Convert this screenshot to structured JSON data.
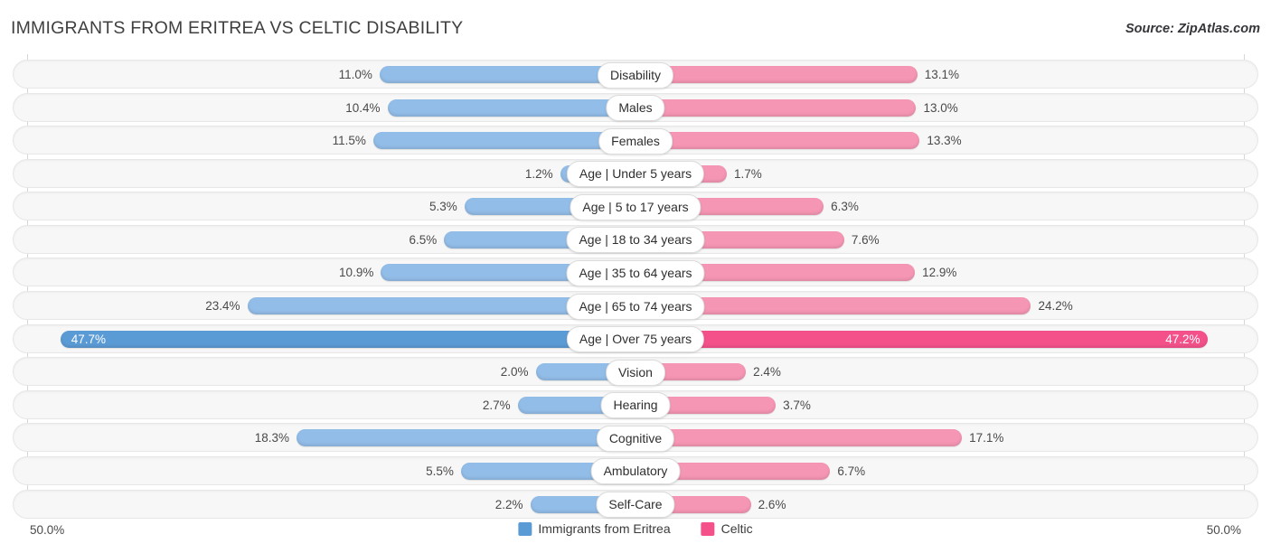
{
  "header": {
    "title": "IMMIGRANTS FROM ERITREA VS CELTIC DISABILITY",
    "source": "Source: ZipAtlas.com"
  },
  "axis": {
    "left_label": "50.0%",
    "right_label": "50.0%",
    "max": 50.0
  },
  "legend": {
    "items": [
      {
        "label": "Immigrants from Eritrea",
        "color": "#5b9bd5"
      },
      {
        "label": "Celtic",
        "color": "#f4518b"
      }
    ]
  },
  "colors": {
    "left_normal": "#92bde8",
    "right_normal": "#f596b4",
    "left_highlight": "#5b9bd5",
    "right_highlight": "#f4518b",
    "track": "#f7f7f7",
    "track_border": "#e7e7e7",
    "gridline": "#d6d6d6"
  },
  "chart_data": {
    "type": "bar",
    "orientation": "horizontal-diverging",
    "title": "IMMIGRANTS FROM ERITREA VS CELTIC DISABILITY",
    "xlabel": "",
    "ylabel": "",
    "xlim": [
      -50.0,
      50.0
    ],
    "grid": false,
    "legend_position": "bottom-center",
    "categories": [
      "Disability",
      "Males",
      "Females",
      "Age | Under 5 years",
      "Age | 5 to 17 years",
      "Age | 18 to 34 years",
      "Age | 35 to 64 years",
      "Age | 65 to 74 years",
      "Age | Over 75 years",
      "Vision",
      "Hearing",
      "Cognitive",
      "Ambulatory",
      "Self-Care"
    ],
    "series": [
      {
        "name": "Immigrants from Eritrea",
        "color": "#5b9bd5",
        "values": [
          11.0,
          10.4,
          11.5,
          1.2,
          5.3,
          6.5,
          10.9,
          23.4,
          47.7,
          2.0,
          2.7,
          18.3,
          5.5,
          2.2
        ],
        "labels": [
          "11.0%",
          "10.4%",
          "11.5%",
          "1.2%",
          "5.3%",
          "6.5%",
          "10.9%",
          "23.4%",
          "47.7%",
          "2.0%",
          "2.7%",
          "18.3%",
          "5.5%",
          "2.2%"
        ]
      },
      {
        "name": "Celtic",
        "color": "#f4518b",
        "values": [
          13.1,
          13.0,
          13.3,
          1.7,
          6.3,
          7.6,
          12.9,
          24.2,
          47.2,
          2.4,
          3.7,
          17.1,
          6.7,
          2.6
        ],
        "labels": [
          "13.1%",
          "13.0%",
          "13.3%",
          "1.7%",
          "6.3%",
          "7.6%",
          "12.9%",
          "24.2%",
          "47.2%",
          "2.4%",
          "3.7%",
          "17.1%",
          "6.7%",
          "2.6%"
        ]
      }
    ],
    "highlighted_rows": [
      8
    ]
  }
}
